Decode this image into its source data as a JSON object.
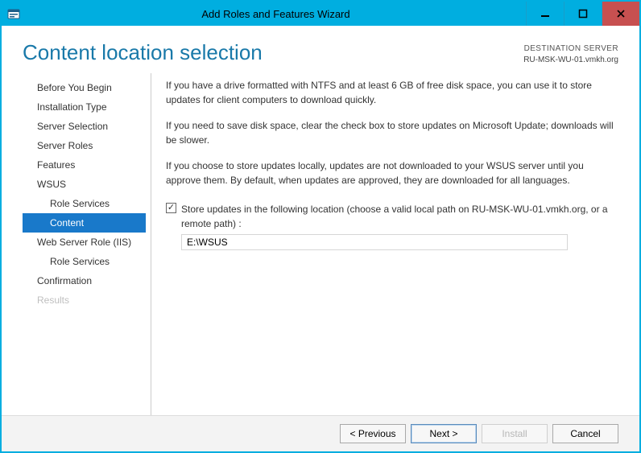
{
  "window": {
    "title": "Add Roles and Features Wizard"
  },
  "header": {
    "page_title": "Content location selection",
    "destination_label": "DESTINATION SERVER",
    "destination_value": "RU-MSK-WU-01.vmkh.org"
  },
  "nav": {
    "items": [
      {
        "key": "before",
        "label": "Before You Begin",
        "indent": 0,
        "selected": false,
        "disabled": false
      },
      {
        "key": "install_type",
        "label": "Installation Type",
        "indent": 0,
        "selected": false,
        "disabled": false
      },
      {
        "key": "server_selection",
        "label": "Server Selection",
        "indent": 0,
        "selected": false,
        "disabled": false
      },
      {
        "key": "server_roles",
        "label": "Server Roles",
        "indent": 0,
        "selected": false,
        "disabled": false
      },
      {
        "key": "features",
        "label": "Features",
        "indent": 0,
        "selected": false,
        "disabled": false
      },
      {
        "key": "wsus",
        "label": "WSUS",
        "indent": 0,
        "selected": false,
        "disabled": false
      },
      {
        "key": "wsus_role_services",
        "label": "Role Services",
        "indent": 1,
        "selected": false,
        "disabled": false
      },
      {
        "key": "wsus_content",
        "label": "Content",
        "indent": 1,
        "selected": true,
        "disabled": false
      },
      {
        "key": "iis",
        "label": "Web Server Role (IIS)",
        "indent": 0,
        "selected": false,
        "disabled": false
      },
      {
        "key": "iis_role_services",
        "label": "Role Services",
        "indent": 1,
        "selected": false,
        "disabled": false
      },
      {
        "key": "confirmation",
        "label": "Confirmation",
        "indent": 0,
        "selected": false,
        "disabled": false
      },
      {
        "key": "results",
        "label": "Results",
        "indent": 0,
        "selected": false,
        "disabled": true
      }
    ]
  },
  "content": {
    "para1": "If you have a drive formatted with NTFS and at least 6 GB of free disk space, you can use it to store updates for client computers to download quickly.",
    "para2": "If you need to save disk space, clear the check box to store updates on Microsoft Update; downloads will be slower.",
    "para3": "If you choose to store updates locally, updates are not downloaded to your WSUS server until you approve them. By default, when updates are approved, they are downloaded for all languages.",
    "checkbox_checked": true,
    "checkbox_label": "Store updates in the following location (choose a valid local path on RU-MSK-WU-01.vmkh.org, or a remote path) :",
    "path_value": "E:\\WSUS"
  },
  "footer": {
    "prev": "< Previous",
    "next": "Next >",
    "install": "Install",
    "cancel": "Cancel",
    "install_enabled": false
  }
}
